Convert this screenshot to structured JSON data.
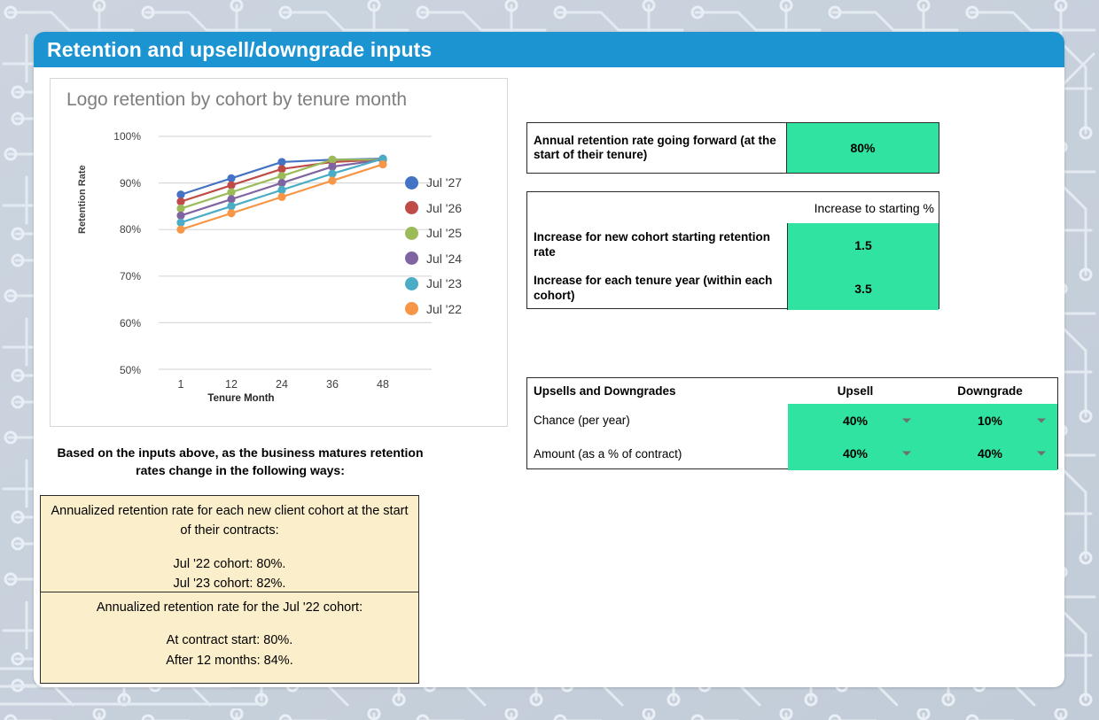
{
  "header": {
    "title": "Retention and upsell/downgrade inputs",
    "bar_color": "#1c94d2"
  },
  "chart_panel": {
    "title": "Logo retention by cohort by tenure month"
  },
  "chart_data": {
    "type": "line",
    "title": "Logo retention by cohort by tenure month",
    "xlabel": "Tenure Month",
    "ylabel": "Retention Rate",
    "x": [
      1,
      12,
      24,
      36,
      48
    ],
    "xtick_labels": [
      "1",
      "12",
      "24",
      "36",
      "48"
    ],
    "ytick_labels": [
      "100%",
      "90%",
      "80%",
      "70%",
      "60%",
      "50%"
    ],
    "ytick_values": [
      100,
      90,
      80,
      70,
      60,
      50
    ],
    "ylim": [
      50,
      100
    ],
    "grid": "horizontal",
    "legend_position": "right",
    "series": [
      {
        "name": "Jul '27",
        "color": "#4472C4",
        "values": [
          87.5,
          91.0,
          94.5,
          95.0,
          95.2
        ]
      },
      {
        "name": "Jul '26",
        "color": "#BE4B48",
        "values": [
          86.0,
          89.5,
          93.0,
          94.5,
          95.0
        ]
      },
      {
        "name": "Jul '25",
        "color": "#9BBB59",
        "values": [
          84.5,
          88.0,
          91.5,
          95.0,
          95.0
        ]
      },
      {
        "name": "Jul '24",
        "color": "#8064A2",
        "values": [
          83.0,
          86.5,
          90.0,
          93.5,
          95.0
        ]
      },
      {
        "name": "Jul '23",
        "color": "#4BACC6",
        "values": [
          81.5,
          85.0,
          88.5,
          92.0,
          95.2
        ]
      },
      {
        "name": "Jul '22",
        "color": "#F79646",
        "values": [
          80.0,
          83.5,
          87.0,
          90.5,
          94.0
        ]
      }
    ]
  },
  "annual_table": {
    "label": "Annual retention rate going forward (at the start of their tenure)",
    "value": "80%",
    "value_bg": "#31e3a0"
  },
  "increase_table": {
    "column_header": "Increase to starting %",
    "rows": [
      {
        "label": "Increase for new cohort starting retention rate",
        "value": "1.5"
      },
      {
        "label": "Increase for each tenure year (within each cohort)",
        "value": "3.5"
      }
    ]
  },
  "upsell_table": {
    "title": "Upsells and Downgrades",
    "col_upsell": "Upsell",
    "col_downgrade": "Downgrade",
    "rows": [
      {
        "label": "Chance (per year)",
        "upsell": "40%",
        "downgrade": "10%"
      },
      {
        "label": "Amount (as a % of contract)",
        "upsell": "40%",
        "downgrade": "40%"
      }
    ]
  },
  "narrative": {
    "heading": "Based on the inputs above, as the business matures retention rates change in the following ways:",
    "box1_line1": "Annualized retention rate for each new client cohort at the start of their contracts:",
    "box1_line2": "Jul '22 cohort: 80%.",
    "box1_line3": "Jul '23 cohort: 82%.",
    "box2_line1": "Annualized retention rate for the Jul '22 cohort:",
    "box2_line2": "At contract start: 80%.",
    "box2_line3": "After 12 months: 84%."
  }
}
